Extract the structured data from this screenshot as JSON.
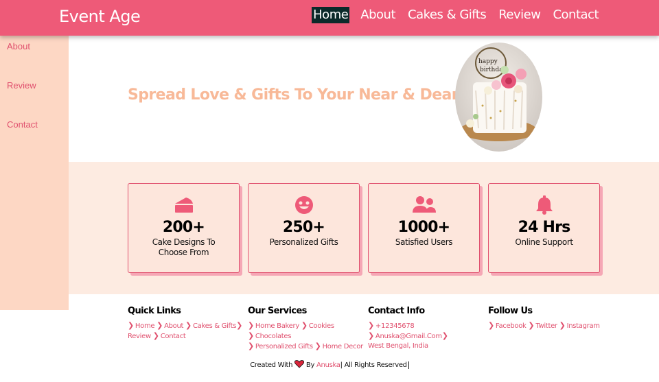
{
  "brand": "Event Age",
  "nav": [
    "Home",
    "About",
    "Cakes & Gifts",
    "Review",
    "Contact"
  ],
  "sidebar": [
    "About",
    "Review",
    "Contact"
  ],
  "hero": {
    "title": "Spread Love & Gifts To Your Near & Dear Ones",
    "image_alt": "Happy Birthday cake"
  },
  "stats": [
    {
      "icon": "cake-icon",
      "number": "200+",
      "label": "Cake Designs To Choose From"
    },
    {
      "icon": "smile-icon",
      "number": "250+",
      "label": "Personalized Gifts"
    },
    {
      "icon": "users-icon",
      "number": "1000+",
      "label": "Satisfied Users"
    },
    {
      "icon": "bell-icon",
      "number": "24 Hrs",
      "label": "Online Support"
    }
  ],
  "footer": {
    "quick_links": {
      "title": "Quick Links",
      "items": [
        "Home",
        "About",
        "Cakes & Gifts",
        "Review",
        "Contact"
      ]
    },
    "services": {
      "title": "Our Services",
      "items": [
        "Home Bakery",
        "Cookies",
        "Chocolates",
        "Personalized Gifts",
        "Home Decor"
      ]
    },
    "contact": {
      "title": "Contact Info",
      "items": [
        "+12345678",
        "Anuska@Gmail.Com"
      ],
      "address": "West Bengal, India"
    },
    "follow": {
      "title": "Follow Us",
      "items": [
        "Facebook",
        "Twitter",
        "Instagram"
      ]
    }
  },
  "credit": {
    "prefix": "Created With",
    "by": "By",
    "author": "Anuska",
    "suffix": "| All Rights Reserved"
  },
  "colors": {
    "primary": "#ee5a78",
    "sidebar": "#fdd7c4",
    "band": "#fdebe1",
    "hero_text": "#f8b998",
    "active_nav": "#0c2a2a"
  }
}
